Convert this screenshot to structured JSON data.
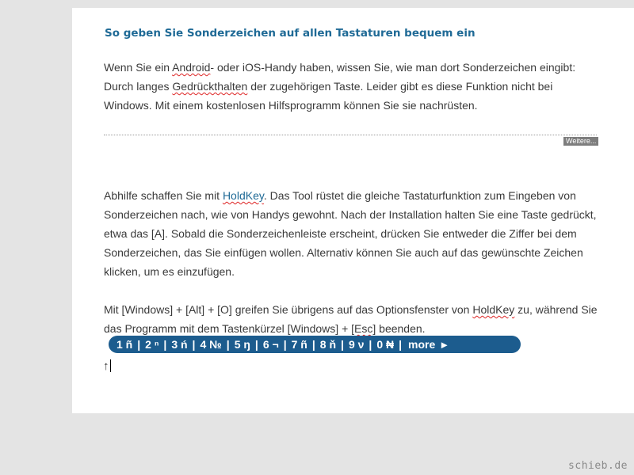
{
  "article": {
    "title": "So geben Sie Sonderzeichen auf allen Tastaturen bequem ein",
    "intro": {
      "t1": "Wenn Sie ein ",
      "android": "Android",
      "t2": "- oder iOS-Handy haben, wissen Sie, wie man dort Sonderzeichen eingibt: Durch langes ",
      "gedruckt": "Gedrückthalten",
      "t3": " der zugehörigen Taste. Leider gibt es diese Funktion nicht bei Windows. Mit einem kostenlosen Hilfsprogramm können Sie sie nachrüsten."
    },
    "more_label": "Weitere...",
    "body1": {
      "t1": "Abhilfe schaffen Sie mit ",
      "link": "HoldKey",
      "t2": ". Das Tool rüstet die gleiche Tastaturfunktion zum Eingeben von Sonderzeichen nach, wie von Handys gewohnt. Nach der Installation halten Sie eine Taste gedrückt, etwa das [A]. Sobald die Sonderzeichenleiste erscheint, drücken Sie entweder die Ziffer bei dem Sonderzeichen, das Sie einfügen wollen. Alternativ können Sie auch auf das gewünschte Zeichen klicken, um es einzufügen."
    },
    "body2": {
      "t1": "Mit [Windows] + [Alt] + [O] greifen Sie übrigens auf das Optionsfenster von ",
      "holdkey": "HoldKey",
      "t2": " zu, während Sie das Programm mit dem Tastenkürzel [Windows] + [",
      "esc": "Esc",
      "t3": "] beenden."
    }
  },
  "picker": {
    "items": [
      "1 ñ",
      "2 ⁿ",
      "3 ń",
      "4 №",
      "5 ŋ",
      "6 ¬",
      "7 ñ",
      "8 ň",
      "9 ν",
      "0 ₦"
    ],
    "separator": "|",
    "more_label": "more",
    "more_arrow": "►"
  },
  "editor": {
    "typed_char": "↑"
  },
  "watermark": "schieb.de"
}
